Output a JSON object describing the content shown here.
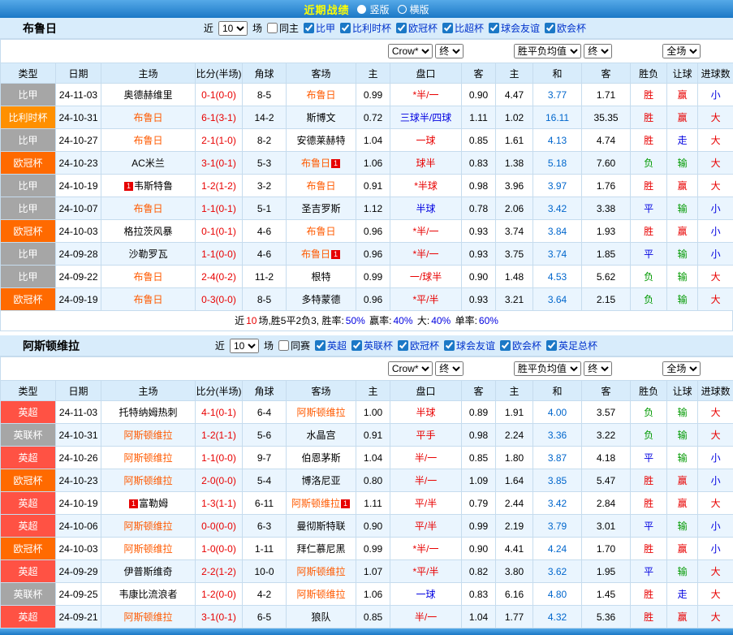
{
  "topbar": {
    "title": "近期战绩",
    "options": [
      {
        "label": "竖版",
        "selected": true
      },
      {
        "label": "横版",
        "selected": false
      }
    ]
  },
  "colors": {
    "bar_blue": "#1b78c6",
    "header_light_blue": "#d8ecfb",
    "row_alt_blue": "#eaf5fe",
    "focal_team_orange": "#ff5a00",
    "score_red": "#e80000",
    "win_red": "#e80000",
    "draw_blue": "#0000e0",
    "lose_green": "#009900",
    "avg_draw_blue": "#0066cc",
    "type_gray": "#a6a6a6",
    "type_orange": "#ff9000",
    "type_deep_orange": "#ff6a00",
    "type_red": "#ff5244"
  },
  "controls": {
    "near_label": "近",
    "matches_value": "10",
    "games_label": "场",
    "odds_company": "Crow*",
    "final_label": "终",
    "avg_label": "胜平负均值",
    "scope_label": "全场"
  },
  "table_header": [
    "类型",
    "日期",
    "主场",
    "比分(半场)",
    "角球",
    "客场",
    "主",
    "盘口",
    "客",
    "主",
    "和",
    "客",
    "胜负",
    "让球",
    "进球数"
  ],
  "sections": [
    {
      "team": "布鲁日",
      "same_label": "同主",
      "leagues": [
        "比甲",
        "比利时杯",
        "欧冠杯",
        "比超杯",
        "球会友谊",
        "欧会杯"
      ],
      "rows": [
        {
          "type": "比甲",
          "type_color": "gray",
          "date": "24-11-03",
          "home": "奥德赫维里",
          "home_focal": false,
          "home_red": 0,
          "score": "0-1(0-0)",
          "corners": "8-5",
          "away": "布鲁日",
          "away_focal": true,
          "away_red": 0,
          "odds_home": "0.99",
          "handicap": "*半/一",
          "handicap_color": "red",
          "odds_away": "0.90",
          "avg_home": "4.47",
          "avg_draw": "3.77",
          "avg_away": "1.71",
          "result": "胜",
          "result_color": "red",
          "let_result": "赢",
          "let_color": "red",
          "goals": "小",
          "goals_color": "blue"
        },
        {
          "type": "比利时杯",
          "type_color": "orange",
          "date": "24-10-31",
          "home": "布鲁日",
          "home_focal": true,
          "home_red": 0,
          "score": "6-1(3-1)",
          "corners": "14-2",
          "away": "斯博文",
          "away_focal": false,
          "away_red": 0,
          "odds_home": "0.72",
          "handicap": "三球半/四球",
          "handicap_color": "blue",
          "odds_away": "1.11",
          "avg_home": "1.02",
          "avg_draw": "16.11",
          "avg_away": "35.35",
          "result": "胜",
          "result_color": "red",
          "let_result": "赢",
          "let_color": "red",
          "goals": "大",
          "goals_color": "red"
        },
        {
          "type": "比甲",
          "type_color": "gray",
          "date": "24-10-27",
          "home": "布鲁日",
          "home_focal": true,
          "home_red": 0,
          "score": "2-1(1-0)",
          "corners": "8-2",
          "away": "安德莱赫特",
          "away_focal": false,
          "away_red": 0,
          "odds_home": "1.04",
          "handicap": "一球",
          "handicap_color": "red",
          "odds_away": "0.85",
          "avg_home": "1.61",
          "avg_draw": "4.13",
          "avg_away": "4.74",
          "result": "胜",
          "result_color": "red",
          "let_result": "走",
          "let_color": "blue",
          "goals": "大",
          "goals_color": "red"
        },
        {
          "type": "欧冠杯",
          "type_color": "orange2",
          "date": "24-10-23",
          "home": "AC米兰",
          "home_focal": false,
          "home_red": 0,
          "score": "3-1(0-1)",
          "corners": "5-3",
          "away": "布鲁日",
          "away_focal": true,
          "away_red": 1,
          "odds_home": "1.06",
          "handicap": "球半",
          "handicap_color": "red",
          "odds_away": "0.83",
          "avg_home": "1.38",
          "avg_draw": "5.18",
          "avg_away": "7.60",
          "result": "负",
          "result_color": "green",
          "let_result": "输",
          "let_color": "green",
          "goals": "大",
          "goals_color": "red"
        },
        {
          "type": "比甲",
          "type_color": "gray",
          "date": "24-10-19",
          "home": "韦斯特鲁",
          "home_focal": false,
          "home_red": 1,
          "score": "1-2(1-2)",
          "corners": "3-2",
          "away": "布鲁日",
          "away_focal": true,
          "away_red": 0,
          "odds_home": "0.91",
          "handicap": "*半球",
          "handicap_color": "red",
          "odds_away": "0.98",
          "avg_home": "3.96",
          "avg_draw": "3.97",
          "avg_away": "1.76",
          "result": "胜",
          "result_color": "red",
          "let_result": "赢",
          "let_color": "red",
          "goals": "大",
          "goals_color": "red"
        },
        {
          "type": "比甲",
          "type_color": "gray",
          "date": "24-10-07",
          "home": "布鲁日",
          "home_focal": true,
          "home_red": 0,
          "score": "1-1(0-1)",
          "corners": "5-1",
          "away": "圣吉罗斯",
          "away_focal": false,
          "away_red": 0,
          "odds_home": "1.12",
          "handicap": "半球",
          "handicap_color": "blue",
          "odds_away": "0.78",
          "avg_home": "2.06",
          "avg_draw": "3.42",
          "avg_away": "3.38",
          "result": "平",
          "result_color": "blue",
          "let_result": "输",
          "let_color": "green",
          "goals": "小",
          "goals_color": "blue"
        },
        {
          "type": "欧冠杯",
          "type_color": "orange2",
          "date": "24-10-03",
          "home": "格拉茨风暴",
          "home_focal": false,
          "home_red": 0,
          "score": "0-1(0-1)",
          "corners": "4-6",
          "away": "布鲁日",
          "away_focal": true,
          "away_red": 0,
          "odds_home": "0.96",
          "handicap": "*半/一",
          "handicap_color": "red",
          "odds_away": "0.93",
          "avg_home": "3.74",
          "avg_draw": "3.84",
          "avg_away": "1.93",
          "result": "胜",
          "result_color": "red",
          "let_result": "赢",
          "let_color": "red",
          "goals": "小",
          "goals_color": "blue"
        },
        {
          "type": "比甲",
          "type_color": "gray",
          "date": "24-09-28",
          "home": "沙勒罗瓦",
          "home_focal": false,
          "home_red": 0,
          "score": "1-1(0-0)",
          "corners": "4-6",
          "away": "布鲁日",
          "away_focal": true,
          "away_red": 1,
          "odds_home": "0.96",
          "handicap": "*半/一",
          "handicap_color": "red",
          "odds_away": "0.93",
          "avg_home": "3.75",
          "avg_draw": "3.74",
          "avg_away": "1.85",
          "result": "平",
          "result_color": "blue",
          "let_result": "输",
          "let_color": "green",
          "goals": "小",
          "goals_color": "blue"
        },
        {
          "type": "比甲",
          "type_color": "gray",
          "date": "24-09-22",
          "home": "布鲁日",
          "home_focal": true,
          "home_red": 0,
          "score": "2-4(0-2)",
          "corners": "11-2",
          "away": "根特",
          "away_focal": false,
          "away_red": 0,
          "odds_home": "0.99",
          "handicap": "一/球半",
          "handicap_color": "red",
          "odds_away": "0.90",
          "avg_home": "1.48",
          "avg_draw": "4.53",
          "avg_away": "5.62",
          "result": "负",
          "result_color": "green",
          "let_result": "输",
          "let_color": "green",
          "goals": "大",
          "goals_color": "red"
        },
        {
          "type": "欧冠杯",
          "type_color": "orange2",
          "date": "24-09-19",
          "home": "布鲁日",
          "home_focal": true,
          "home_red": 0,
          "score": "0-3(0-0)",
          "corners": "8-5",
          "away": "多特蒙德",
          "away_focal": false,
          "away_red": 0,
          "odds_home": "0.96",
          "handicap": "*平/半",
          "handicap_color": "red",
          "odds_away": "0.93",
          "avg_home": "3.21",
          "avg_draw": "3.64",
          "avg_away": "2.15",
          "result": "负",
          "result_color": "green",
          "let_result": "输",
          "let_color": "green",
          "goals": "大",
          "goals_color": "red"
        }
      ],
      "summary": [
        {
          "text": "近",
          "color": "black"
        },
        {
          "text": "10",
          "color": "red"
        },
        {
          "text": "场,胜5平2负3, 胜率:",
          "color": "black"
        },
        {
          "text": "50%",
          "color": "blue"
        },
        {
          "text": " 赢率:",
          "color": "black"
        },
        {
          "text": "40%",
          "color": "blue"
        },
        {
          "text": " 大:",
          "color": "black"
        },
        {
          "text": "40%",
          "color": "blue"
        },
        {
          "text": " 单率:",
          "color": "black"
        },
        {
          "text": "60%",
          "color": "blue"
        }
      ]
    },
    {
      "team": "阿斯顿维拉",
      "same_label": "同赛",
      "leagues": [
        "英超",
        "英联杯",
        "欧冠杯",
        "球会友谊",
        "欧会杯",
        "英足总杯"
      ],
      "rows": [
        {
          "type": "英超",
          "type_color": "red",
          "date": "24-11-03",
          "home": "托特纳姆热刺",
          "home_focal": false,
          "home_red": 0,
          "score": "4-1(0-1)",
          "corners": "6-4",
          "away": "阿斯顿维拉",
          "away_focal": true,
          "away_red": 0,
          "odds_home": "1.00",
          "handicap": "半球",
          "handicap_color": "red",
          "odds_away": "0.89",
          "avg_home": "1.91",
          "avg_draw": "4.00",
          "avg_away": "3.57",
          "result": "负",
          "result_color": "green",
          "let_result": "输",
          "let_color": "green",
          "goals": "大",
          "goals_color": "red"
        },
        {
          "type": "英联杯",
          "type_color": "gray",
          "date": "24-10-31",
          "home": "阿斯顿维拉",
          "home_focal": true,
          "home_red": 0,
          "score": "1-2(1-1)",
          "corners": "5-6",
          "away": "水晶宫",
          "away_focal": false,
          "away_red": 0,
          "odds_home": "0.91",
          "handicap": "平手",
          "handicap_color": "red",
          "odds_away": "0.98",
          "avg_home": "2.24",
          "avg_draw": "3.36",
          "avg_away": "3.22",
          "result": "负",
          "result_color": "green",
          "let_result": "输",
          "let_color": "green",
          "goals": "大",
          "goals_color": "red"
        },
        {
          "type": "英超",
          "type_color": "red",
          "date": "24-10-26",
          "home": "阿斯顿维拉",
          "home_focal": true,
          "home_red": 0,
          "score": "1-1(0-0)",
          "corners": "9-7",
          "away": "伯恩茅斯",
          "away_focal": false,
          "away_red": 0,
          "odds_home": "1.04",
          "handicap": "半/一",
          "handicap_color": "red",
          "odds_away": "0.85",
          "avg_home": "1.80",
          "avg_draw": "3.87",
          "avg_away": "4.18",
          "result": "平",
          "result_color": "blue",
          "let_result": "输",
          "let_color": "green",
          "goals": "小",
          "goals_color": "blue"
        },
        {
          "type": "欧冠杯",
          "type_color": "orange2",
          "date": "24-10-23",
          "home": "阿斯顿维拉",
          "home_focal": true,
          "home_red": 0,
          "score": "2-0(0-0)",
          "corners": "5-4",
          "away": "博洛尼亚",
          "away_focal": false,
          "away_red": 0,
          "odds_home": "0.80",
          "handicap": "半/一",
          "handicap_color": "red",
          "odds_away": "1.09",
          "avg_home": "1.64",
          "avg_draw": "3.85",
          "avg_away": "5.47",
          "result": "胜",
          "result_color": "red",
          "let_result": "赢",
          "let_color": "red",
          "goals": "小",
          "goals_color": "blue"
        },
        {
          "type": "英超",
          "type_color": "red",
          "date": "24-10-19",
          "home": "富勒姆",
          "home_focal": false,
          "home_red": 1,
          "score": "1-3(1-1)",
          "corners": "6-11",
          "away": "阿斯顿维拉",
          "away_focal": true,
          "away_red": 1,
          "odds_home": "1.11",
          "handicap": "平/半",
          "handicap_color": "red",
          "odds_away": "0.79",
          "avg_home": "2.44",
          "avg_draw": "3.42",
          "avg_away": "2.84",
          "result": "胜",
          "result_color": "red",
          "let_result": "赢",
          "let_color": "red",
          "goals": "大",
          "goals_color": "red"
        },
        {
          "type": "英超",
          "type_color": "red",
          "date": "24-10-06",
          "home": "阿斯顿维拉",
          "home_focal": true,
          "home_red": 0,
          "score": "0-0(0-0)",
          "corners": "6-3",
          "away": "曼彻斯特联",
          "away_focal": false,
          "away_red": 0,
          "odds_home": "0.90",
          "handicap": "平/半",
          "handicap_color": "red",
          "odds_away": "0.99",
          "avg_home": "2.19",
          "avg_draw": "3.79",
          "avg_away": "3.01",
          "result": "平",
          "result_color": "blue",
          "let_result": "输",
          "let_color": "green",
          "goals": "小",
          "goals_color": "blue"
        },
        {
          "type": "欧冠杯",
          "type_color": "orange2",
          "date": "24-10-03",
          "home": "阿斯顿维拉",
          "home_focal": true,
          "home_red": 0,
          "score": "1-0(0-0)",
          "corners": "1-11",
          "away": "拜仁慕尼黑",
          "away_focal": false,
          "away_red": 0,
          "odds_home": "0.99",
          "handicap": "*半/一",
          "handicap_color": "red",
          "odds_away": "0.90",
          "avg_home": "4.41",
          "avg_draw": "4.24",
          "avg_away": "1.70",
          "result": "胜",
          "result_color": "red",
          "let_result": "赢",
          "let_color": "red",
          "goals": "小",
          "goals_color": "blue"
        },
        {
          "type": "英超",
          "type_color": "red",
          "date": "24-09-29",
          "home": "伊普斯维奇",
          "home_focal": false,
          "home_red": 0,
          "score": "2-2(1-2)",
          "corners": "10-0",
          "away": "阿斯顿维拉",
          "away_focal": true,
          "away_red": 0,
          "odds_home": "1.07",
          "handicap": "*平/半",
          "handicap_color": "red",
          "odds_away": "0.82",
          "avg_home": "3.80",
          "avg_draw": "3.62",
          "avg_away": "1.95",
          "result": "平",
          "result_color": "blue",
          "let_result": "输",
          "let_color": "green",
          "goals": "大",
          "goals_color": "red"
        },
        {
          "type": "英联杯",
          "type_color": "gray",
          "date": "24-09-25",
          "home": "韦康比流浪者",
          "home_focal": false,
          "home_red": 0,
          "score": "1-2(0-0)",
          "corners": "4-2",
          "away": "阿斯顿维拉",
          "away_focal": true,
          "away_red": 0,
          "odds_home": "1.06",
          "handicap": "一球",
          "handicap_color": "blue",
          "odds_away": "0.83",
          "avg_home": "6.16",
          "avg_draw": "4.80",
          "avg_away": "1.45",
          "result": "胜",
          "result_color": "red",
          "let_result": "走",
          "let_color": "blue",
          "goals": "大",
          "goals_color": "red"
        },
        {
          "type": "英超",
          "type_color": "red",
          "date": "24-09-21",
          "home": "阿斯顿维拉",
          "home_focal": true,
          "home_red": 0,
          "score": "3-1(0-1)",
          "corners": "6-5",
          "away": "狼队",
          "away_focal": false,
          "away_red": 0,
          "odds_home": "0.85",
          "handicap": "半/一",
          "handicap_color": "red",
          "odds_away": "1.04",
          "avg_home": "1.77",
          "avg_draw": "4.32",
          "avg_away": "5.36",
          "result": "胜",
          "result_color": "red",
          "let_result": "赢",
          "let_color": "red",
          "goals": "大",
          "goals_color": "red"
        }
      ],
      "summary": null
    }
  ]
}
